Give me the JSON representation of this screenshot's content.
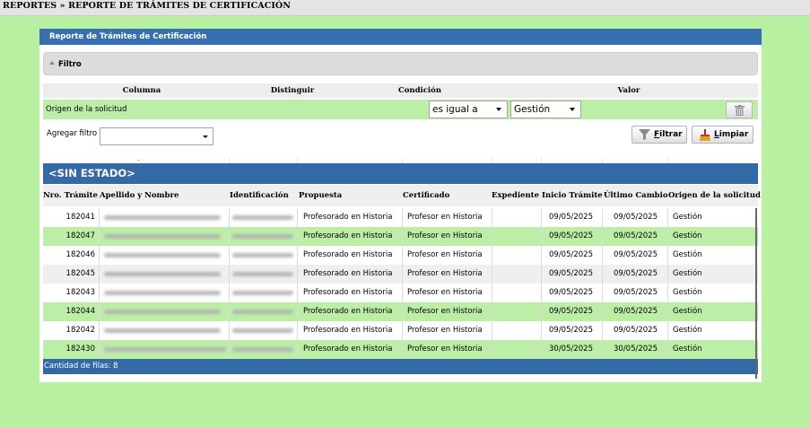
{
  "breadcrumb": "REPORTES » REPORTE DE TRÁMITES DE CERTIFICACIÓN",
  "panel": {
    "title": "Reporte de Trámites de Certificación"
  },
  "filter": {
    "title": "Filtro",
    "headers": {
      "column": "Columna",
      "distinguish": "Distinguir",
      "condition": "Condición",
      "value": "Valor"
    },
    "row": {
      "column": "Origen de la solicitud",
      "condition": "es igual a",
      "value": "Gestión"
    },
    "add_filter_label": "Agregar filtro",
    "add_filter_value": "",
    "filter_button": "iltrar",
    "filter_button_key": "F",
    "clear_button": "impiar",
    "clear_button_key": "L"
  },
  "group": {
    "title": "<SIN ESTADO>",
    "dash": "-"
  },
  "table": {
    "columns": [
      "Nro. Trámite",
      "Apellido y Nombre",
      "Identificación",
      "Propuesta",
      "Certificado",
      "Expediente",
      "Inicio Trámite",
      "Último Cambio",
      "Origen de la solicitud"
    ],
    "rows": [
      {
        "nro": "182041",
        "propuesta": "Profesorado en Historia",
        "certificado": "Profesor en Historia",
        "expediente": "",
        "inicio": "09/05/2025",
        "ultimo": "09/05/2025",
        "origen": "Gestión"
      },
      {
        "nro": "182047",
        "propuesta": "Profesorado en Historia",
        "certificado": "Profesor en Historia",
        "expediente": "",
        "inicio": "09/05/2025",
        "ultimo": "09/05/2025",
        "origen": "Gestión"
      },
      {
        "nro": "182046",
        "propuesta": "Profesorado en Historia",
        "certificado": "Profesor en Historia",
        "expediente": "",
        "inicio": "09/05/2025",
        "ultimo": "09/05/2025",
        "origen": "Gestión"
      },
      {
        "nro": "182045",
        "propuesta": "Profesorado en Historia",
        "certificado": "Profesor en Historia",
        "expediente": "",
        "inicio": "09/05/2025",
        "ultimo": "09/05/2025",
        "origen": "Gestión"
      },
      {
        "nro": "182043",
        "propuesta": "Profesorado en Historia",
        "certificado": "Profesor en Historia",
        "expediente": "",
        "inicio": "09/05/2025",
        "ultimo": "09/05/2025",
        "origen": "Gestión"
      },
      {
        "nro": "182044",
        "propuesta": "Profesorado en Historia",
        "certificado": "Profesor en Historia",
        "expediente": "",
        "inicio": "09/05/2025",
        "ultimo": "09/05/2025",
        "origen": "Gestión"
      },
      {
        "nro": "182042",
        "propuesta": "Profesorado en Historia",
        "certificado": "Profesor en Historia",
        "expediente": "",
        "inicio": "09/05/2025",
        "ultimo": "09/05/2025",
        "origen": "Gestión"
      },
      {
        "nro": "182430",
        "propuesta": "Profesorado en Historia",
        "certificado": "Profesor en Historia",
        "expediente": "",
        "inicio": "30/05/2025",
        "ultimo": "30/05/2025",
        "origen": "Gestión"
      }
    ],
    "footer": "Cantidad de filas: 8"
  },
  "colors": {
    "page_bg": "#b9efa0",
    "header_blue": "#336aa6",
    "row_green": "#bdeea7",
    "row_grey": "#efefef"
  },
  "icons": {
    "filter": "funnel-icon",
    "clear": "broom-icon",
    "delete": "trash-icon",
    "collapse": "triangle-up-icon"
  }
}
